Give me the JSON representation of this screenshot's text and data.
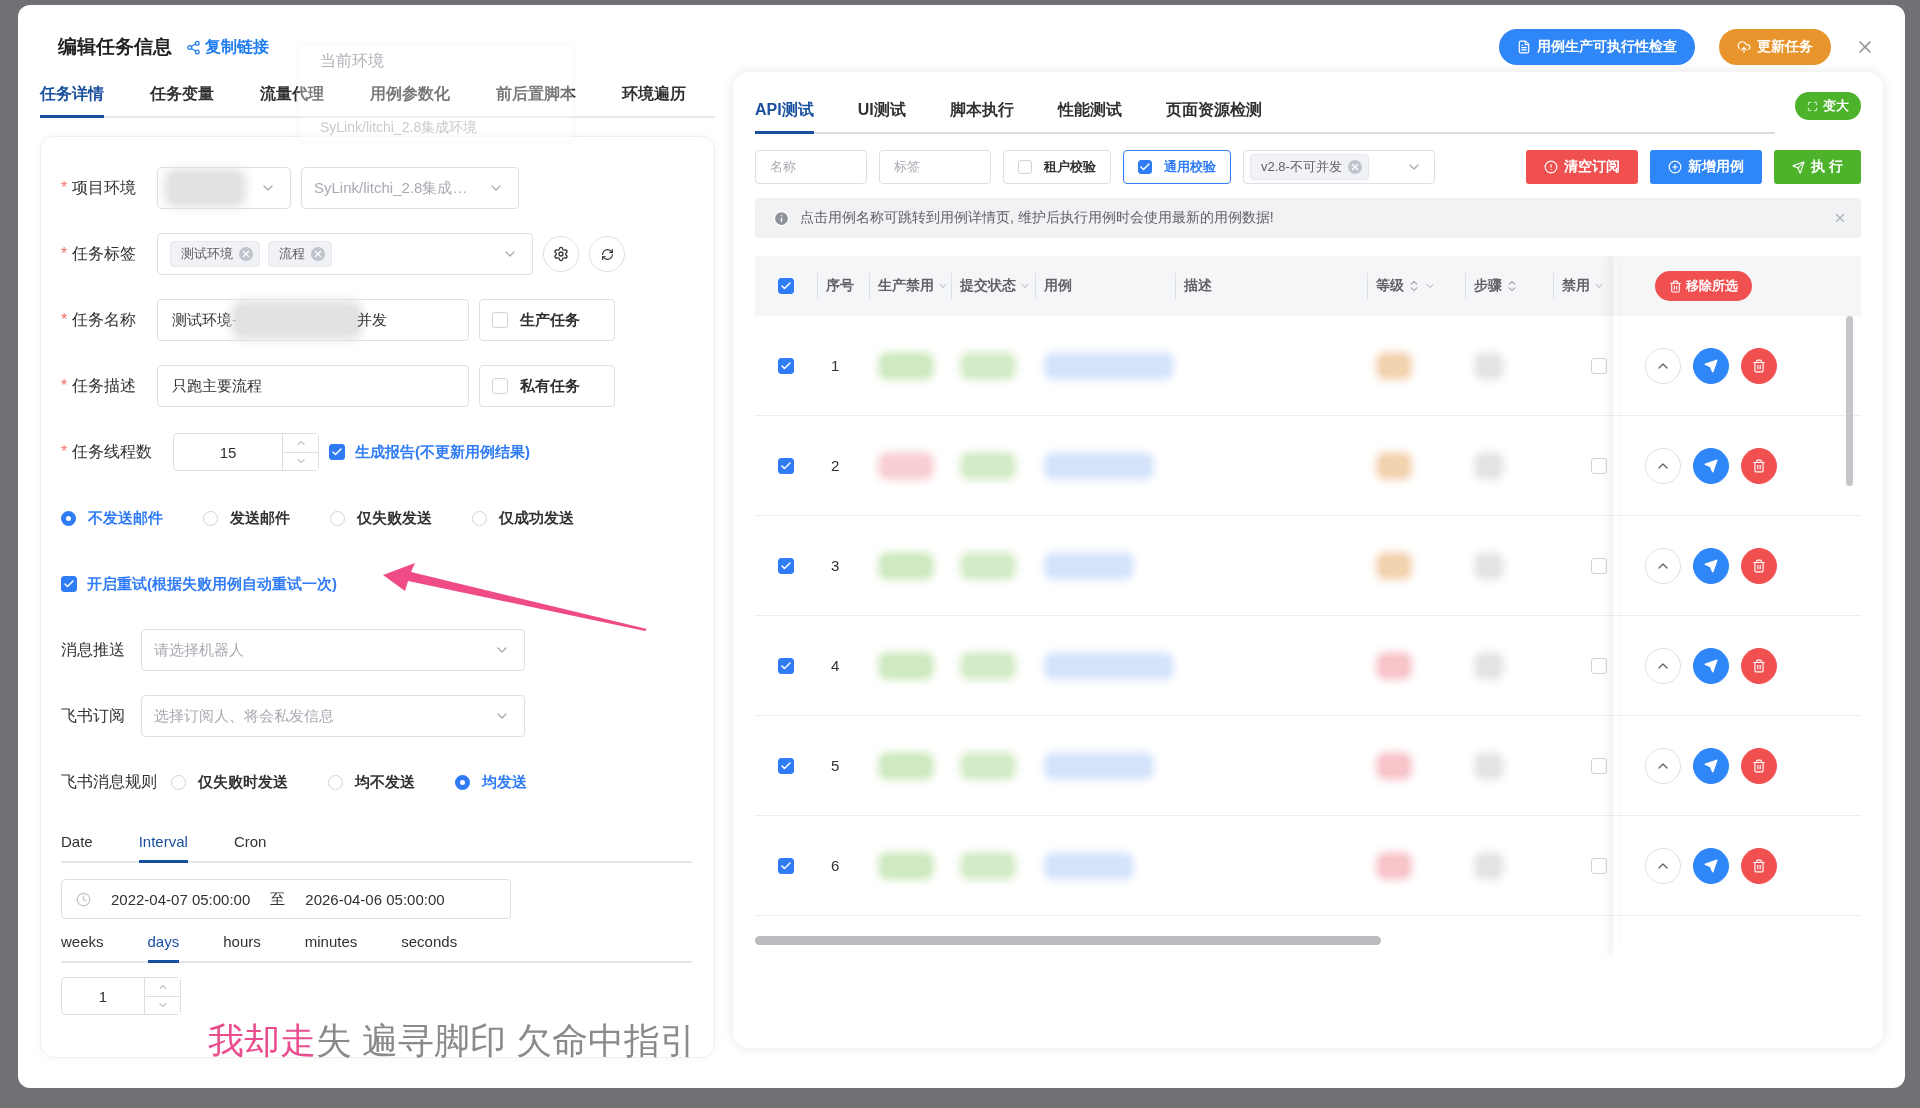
{
  "header": {
    "title": "编辑任务信息",
    "copy_link": "复制链接",
    "check_button": "用例生产可执行性检查",
    "update_button": "更新任务"
  },
  "tooltip": {
    "title": "当前环境",
    "value": "SyLink/litchi_2.8集成环境"
  },
  "left_tabs": [
    {
      "label": "任务详情",
      "selected": true
    },
    {
      "label": "任务变量",
      "selected": false
    },
    {
      "label": "流量代理",
      "selected": false
    },
    {
      "label": "用例参数化",
      "selected": false
    },
    {
      "label": "前后置脚本",
      "selected": false
    },
    {
      "label": "环境遍历",
      "selected": false
    }
  ],
  "form": {
    "env": {
      "required_mark": "*",
      "label": "项目环境",
      "branch": "SyLink/litchi_2.8集成…"
    },
    "tags": {
      "required_mark": "*",
      "label": "任务标签",
      "items": [
        "测试环境",
        "流程"
      ]
    },
    "name": {
      "required_mark": "*",
      "label": "任务名称",
      "value_start": "测试环境-",
      "value_end": "并发",
      "option": {
        "label": "生产任务",
        "checked": false
      }
    },
    "desc": {
      "required_mark": "*",
      "label": "任务描述",
      "value": "只跑主要流程",
      "option": {
        "label": "私有任务",
        "checked": false
      }
    },
    "threads": {
      "required_mark": "*",
      "label": "任务线程数",
      "value": "15",
      "report": {
        "label": "生成报告(不更新用例结果)",
        "checked": true
      }
    },
    "mail_options": [
      {
        "label": "不发送邮件",
        "selected": true
      },
      {
        "label": "发送邮件",
        "selected": false
      },
      {
        "label": "仅失败发送",
        "selected": false
      },
      {
        "label": "仅成功发送",
        "selected": false
      }
    ],
    "retry": {
      "label": "开启重试(根据失败用例自动重试一次)",
      "checked": true
    },
    "robot": {
      "label": "消息推送",
      "placeholder": "请选择机器人"
    },
    "subscribe": {
      "label": "飞书订阅",
      "placeholder": "选择订阅人、将会私发信息"
    },
    "feishu_rule": {
      "label": "飞书消息规则",
      "options": [
        {
          "label": "仅失败时发送",
          "selected": false
        },
        {
          "label": "均不发送",
          "selected": false
        },
        {
          "label": "均发送",
          "selected": true
        }
      ]
    },
    "schedule_tabs": [
      {
        "label": "Date",
        "selected": false
      },
      {
        "label": "Interval",
        "selected": true
      },
      {
        "label": "Cron",
        "selected": false
      }
    ],
    "range": {
      "start": "2022-04-07 05:00:00",
      "sep": "至",
      "end": "2026-04-06 05:00:00"
    },
    "unit_tabs": [
      {
        "label": "weeks",
        "selected": false
      },
      {
        "label": "days",
        "selected": true
      },
      {
        "label": "hours",
        "selected": false
      },
      {
        "label": "minutes",
        "selected": false
      },
      {
        "label": "seconds",
        "selected": false
      }
    ],
    "interval": "1"
  },
  "right": {
    "tabs": [
      {
        "label": "API测试",
        "selected": true
      },
      {
        "label": "UI测试",
        "selected": false
      },
      {
        "label": "脚本执行",
        "selected": false
      },
      {
        "label": "性能测试",
        "selected": false
      },
      {
        "label": "页面资源检测",
        "selected": false
      }
    ],
    "expand": "变大",
    "filters": {
      "name_placeholder": "名称",
      "tag_placeholder": "标签",
      "tenant": {
        "label": "租户校验",
        "checked": false
      },
      "common": {
        "label": "通用校验",
        "checked": true
      },
      "version_tag": "v2.8-不可并发"
    },
    "actions": [
      {
        "label": "清空订阅",
        "kind": "danger"
      },
      {
        "label": "新增用例",
        "kind": "primary"
      },
      {
        "label": "执 行",
        "kind": "success"
      }
    ],
    "notice": "点击用例名称可跳转到用例详情页, 维护后执行用例时会使用最新的用例数据!",
    "table": {
      "all_checked": true,
      "remove_selected": "移除所选",
      "columns": [
        {
          "label": "序号",
          "filter": false,
          "sort": false
        },
        {
          "label": "生产禁用",
          "filter": true,
          "sort": false
        },
        {
          "label": "提交状态",
          "filter": true,
          "sort": false
        },
        {
          "label": "用例",
          "filter": false,
          "sort": false
        },
        {
          "label": "描述",
          "filter": false,
          "sort": false
        },
        {
          "label": "等级",
          "filter": true,
          "sort": true
        },
        {
          "label": "步骤",
          "filter": false,
          "sort": true
        },
        {
          "label": "禁用",
          "filter": true,
          "sort": false
        }
      ],
      "rows": [
        {
          "index": "1",
          "checked": true,
          "disabled": false,
          "prod_tag": {
            "color": "#cfe9c0"
          },
          "level_tag": {
            "color": "#f3d2b0"
          }
        },
        {
          "index": "2",
          "checked": true,
          "disabled": false,
          "prod_tag": {
            "color": "#f8cfd2"
          },
          "level_tag": {
            "color": "#f3d2b0"
          }
        },
        {
          "index": "3",
          "checked": true,
          "disabled": false,
          "prod_tag": {
            "color": "#cfe9c0"
          },
          "level_tag": {
            "color": "#f3d2b0"
          }
        },
        {
          "index": "4",
          "checked": true,
          "disabled": false,
          "prod_tag": {
            "color": "#cfe9c0"
          },
          "level_tag": {
            "color": "#f8c5ca"
          }
        },
        {
          "index": "5",
          "checked": true,
          "disabled": false,
          "prod_tag": {
            "color": "#cfe9c0"
          },
          "level_tag": {
            "color": "#f8c5ca"
          }
        },
        {
          "index": "6",
          "checked": true,
          "disabled": false,
          "prod_tag": {
            "color": "#cfe9c0"
          },
          "level_tag": {
            "color": "#f8c5ca"
          }
        }
      ]
    }
  },
  "subtitle": {
    "sung": "我却走",
    "rest": "失 遍寻脚印 欠命中指引"
  }
}
